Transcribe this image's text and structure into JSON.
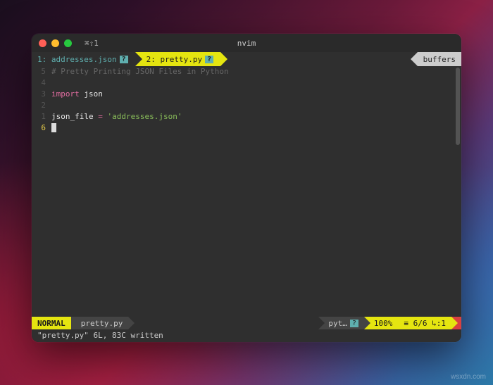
{
  "titlebar": {
    "tab_label": "⌘⇧1",
    "app_name": "nvim"
  },
  "buffers": {
    "tabs": [
      {
        "index": "1:",
        "label": "addresses.json",
        "modified_marker": "?"
      },
      {
        "index": "2:",
        "label": "pretty.py",
        "modified_marker": "?"
      }
    ],
    "buffers_label": "buffers"
  },
  "gutter": {
    "relative": [
      "5",
      "4",
      "3",
      "2",
      "1"
    ],
    "current": "6"
  },
  "code": {
    "line1_comment": "# Pretty Printing JSON Files in Python",
    "line2_empty": "",
    "line3_import_kw": "import",
    "line3_module": "json",
    "line4_empty": "",
    "line5_var": "json_file",
    "line5_op": "=",
    "line5_str": "'addresses.json'"
  },
  "statusline": {
    "mode": "NORMAL",
    "file": "pretty.py",
    "filetype": "pyt…",
    "filetype_marker": "?",
    "percent": "100%",
    "line_count": "≡ 6/6",
    "col": "↳:1"
  },
  "cmdline": {
    "message": "\"pretty.py\" 6L, 83C written"
  },
  "watermark": "wsxdn.com"
}
